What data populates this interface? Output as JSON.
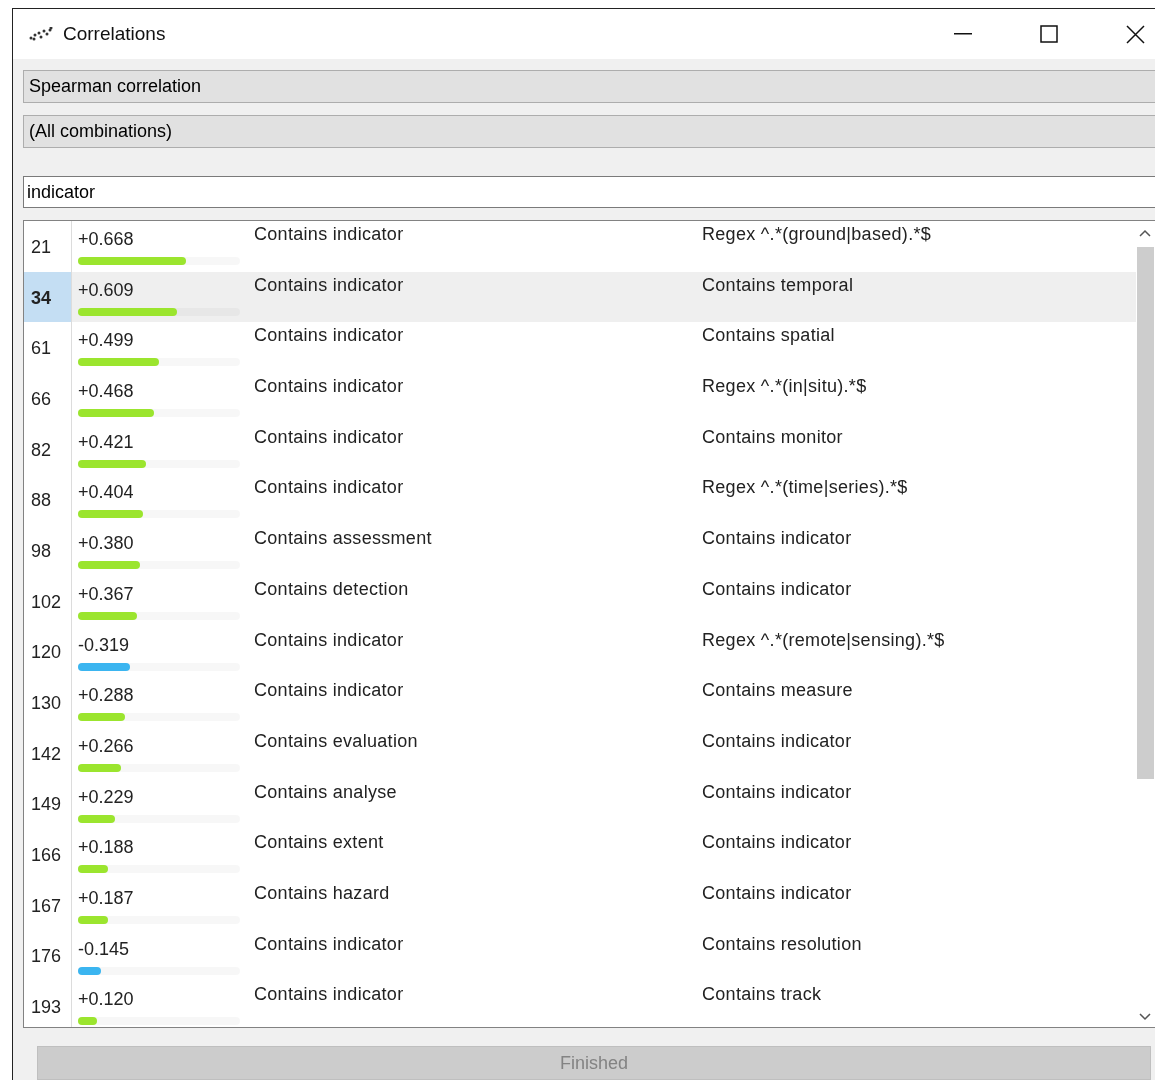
{
  "window": {
    "title": "Correlations"
  },
  "correlation_type": {
    "value": "Spearman correlation"
  },
  "feature_filter": {
    "value": "(All combinations)"
  },
  "search": {
    "value": "indicator"
  },
  "rows": [
    {
      "index": "21",
      "value": "+0.668",
      "level": 0.668,
      "color": "#9be52e",
      "feature_1": "Contains indicator",
      "feature_2": "Regex ^.*(ground|based).*$",
      "selected": false
    },
    {
      "index": "34",
      "value": "+0.609",
      "level": 0.609,
      "color": "#9be52e",
      "feature_1": "Contains indicator",
      "feature_2": "Contains temporal",
      "selected": true
    },
    {
      "index": "61",
      "value": "+0.499",
      "level": 0.499,
      "color": "#9be52e",
      "feature_1": "Contains indicator",
      "feature_2": "Contains spatial",
      "selected": false
    },
    {
      "index": "66",
      "value": "+0.468",
      "level": 0.468,
      "color": "#9be52e",
      "feature_1": "Contains indicator",
      "feature_2": "Regex ^.*(in|situ).*$",
      "selected": false
    },
    {
      "index": "82",
      "value": "+0.421",
      "level": 0.421,
      "color": "#9be52e",
      "feature_1": "Contains indicator",
      "feature_2": "Contains monitor",
      "selected": false
    },
    {
      "index": "88",
      "value": "+0.404",
      "level": 0.404,
      "color": "#9be52e",
      "feature_1": "Contains indicator",
      "feature_2": "Regex ^.*(time|series).*$",
      "selected": false
    },
    {
      "index": "98",
      "value": "+0.380",
      "level": 0.38,
      "color": "#9be52e",
      "feature_1": "Contains assessment",
      "feature_2": "Contains indicator",
      "selected": false
    },
    {
      "index": "102",
      "value": "+0.367",
      "level": 0.367,
      "color": "#9be52e",
      "feature_1": "Contains detection",
      "feature_2": "Contains indicator",
      "selected": false
    },
    {
      "index": "120",
      "value": "-0.319",
      "level": 0.319,
      "color": "#3bb5f0",
      "feature_1": "Contains indicator",
      "feature_2": "Regex ^.*(remote|sensing).*$",
      "selected": false
    },
    {
      "index": "130",
      "value": "+0.288",
      "level": 0.288,
      "color": "#9be52e",
      "feature_1": "Contains indicator",
      "feature_2": "Contains measure",
      "selected": false
    },
    {
      "index": "142",
      "value": "+0.266",
      "level": 0.266,
      "color": "#9be52e",
      "feature_1": "Contains evaluation",
      "feature_2": "Contains indicator",
      "selected": false
    },
    {
      "index": "149",
      "value": "+0.229",
      "level": 0.229,
      "color": "#9be52e",
      "feature_1": "Contains analyse",
      "feature_2": "Contains indicator",
      "selected": false
    },
    {
      "index": "166",
      "value": "+0.188",
      "level": 0.188,
      "color": "#9be52e",
      "feature_1": "Contains extent",
      "feature_2": "Contains indicator",
      "selected": false
    },
    {
      "index": "167",
      "value": "+0.187",
      "level": 0.187,
      "color": "#9be52e",
      "feature_1": "Contains hazard",
      "feature_2": "Contains indicator",
      "selected": false
    },
    {
      "index": "176",
      "value": "-0.145",
      "level": 0.145,
      "color": "#3bb5f0",
      "feature_1": "Contains indicator",
      "feature_2": "Contains resolution",
      "selected": false
    },
    {
      "index": "193",
      "value": "+0.120",
      "level": 0.12,
      "color": "#9be52e",
      "feature_1": "Contains indicator",
      "feature_2": "Contains track",
      "selected": false
    }
  ],
  "finish_button": {
    "label": "Finished",
    "disabled": true
  }
}
